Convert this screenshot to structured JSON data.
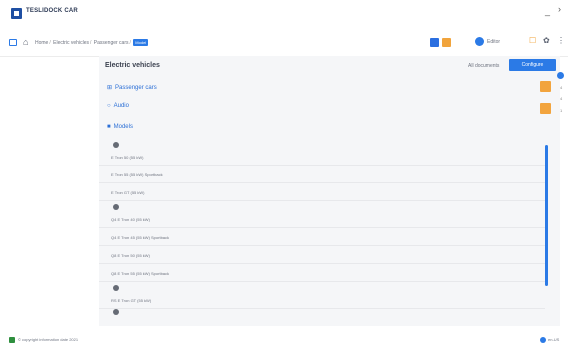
{
  "app": {
    "title": "TESLIDOCK CAR"
  },
  "window": {
    "minimize": "_",
    "close": "›"
  },
  "navbar": {
    "home_icon": "⌂",
    "breadcrumb": [
      "Home",
      "Electric vehicles",
      "Passenger cars"
    ],
    "breadcrumb_badge": "Model",
    "user_label": "Editor",
    "fav_icon": "☐",
    "gear_icon": "✿",
    "more_icon": "⋮"
  },
  "content": {
    "title": "Electric vehicles",
    "doc_count": "All documents",
    "configure_label": "Configure",
    "tree": {
      "passenger_cars": "Passenger cars",
      "buses": "Audio",
      "models": "Models"
    },
    "variants": [
      "E Tron 50 (55 kW)",
      "E Tron 55 (55 kW) Sportback",
      "E Tron GT (55 kW)",
      "Q4 E Tron 40 (55 kW)",
      "Q4 E Tron 45 (55 kW) Sportback",
      "Q8 E Tron 50 (55 kW)",
      "Q8 E Tron 55 (55 kW) Sportback",
      "RS E Tron GT (55 kW)"
    ]
  },
  "side": {
    "d1": "4",
    "d2": "4",
    "d3": "1"
  },
  "status": {
    "text": "© copyright information date 2021",
    "lang": "en-US"
  },
  "colors": {
    "accent": "#2b7ae6",
    "brand": "#1f4fa3",
    "warning": "#f2a43e"
  }
}
